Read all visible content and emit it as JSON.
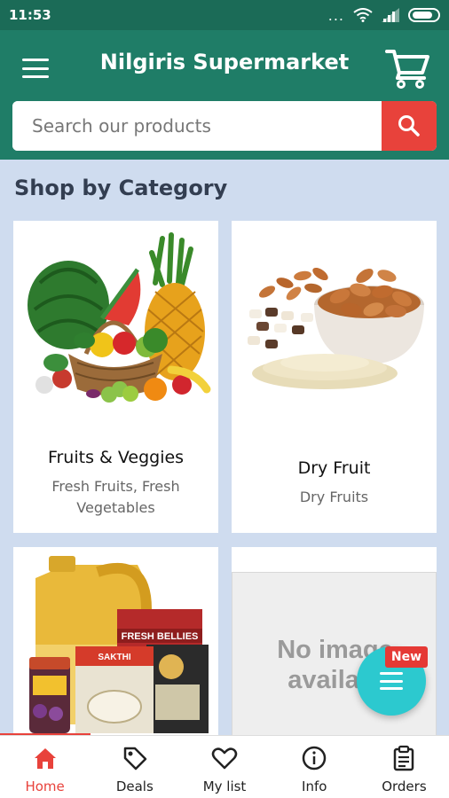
{
  "status_bar": {
    "time": "11:53",
    "dots": "..."
  },
  "app_bar": {
    "title": "Nilgiris Supermarket"
  },
  "search": {
    "placeholder": "Search our products"
  },
  "section": {
    "title": "Shop by Category"
  },
  "categories": [
    {
      "title": "Fruits & Veggies",
      "subtitle": "Fresh Fruits, Fresh Vegetables"
    },
    {
      "title": "Dry Fruit",
      "subtitle": "Dry Fruits"
    },
    {
      "title": "",
      "subtitle": ""
    },
    {
      "title": "",
      "subtitle": "",
      "image_text_line1": "No image",
      "image_text_line2": "availabl"
    }
  ],
  "fab": {
    "badge": "New"
  },
  "bottom_nav": [
    {
      "label": "Home",
      "icon": "home-icon",
      "active": true
    },
    {
      "label": "Deals",
      "icon": "tag-icon"
    },
    {
      "label": "My list",
      "icon": "heart-icon"
    },
    {
      "label": "Info",
      "icon": "info-icon"
    },
    {
      "label": "Orders",
      "icon": "clipboard-icon"
    }
  ],
  "product_packs": {
    "brand": "SAKTHI",
    "pack1": "FRESH BELLIES"
  },
  "colors": {
    "primary": "#1f7d67",
    "accent": "#e8423b",
    "fab": "#2cc9cf",
    "background": "#cfdcef"
  }
}
